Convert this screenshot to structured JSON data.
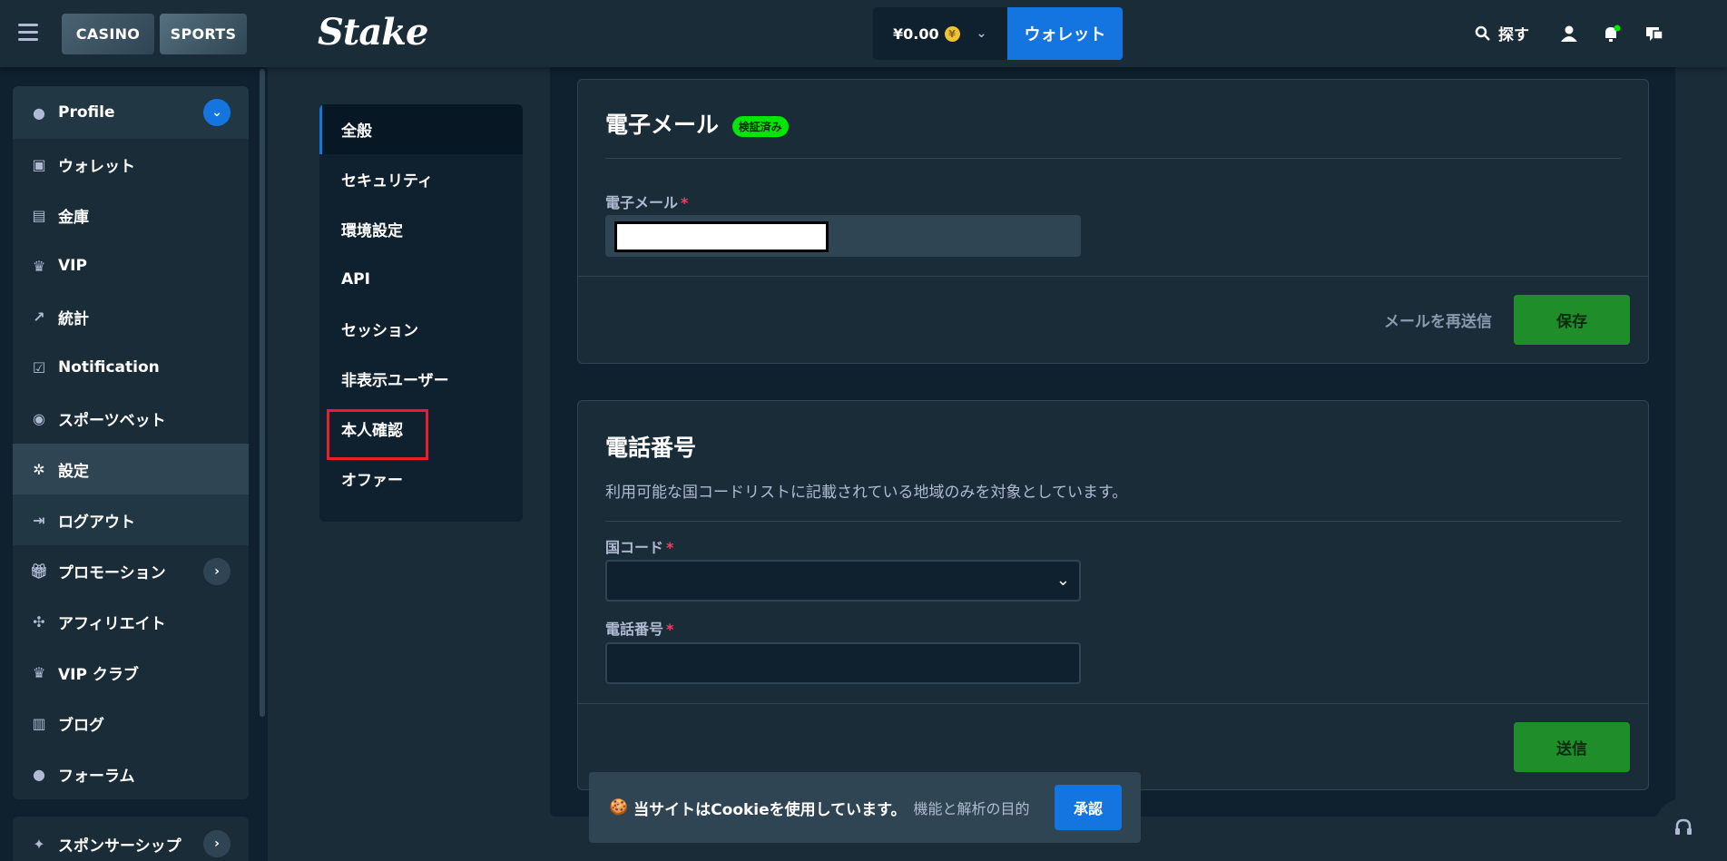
{
  "topbar": {
    "casino": "CASINO",
    "sports": "SPORTS",
    "logo": "Stake",
    "balance": "¥0.00",
    "coin_symbol": "¥",
    "wallet": "ウォレット",
    "search": "探す"
  },
  "sidebar": {
    "items": [
      {
        "label": "Profile",
        "icon": "user-icon"
      },
      {
        "label": "ウォレット",
        "icon": "wallet-icon"
      },
      {
        "label": "金庫",
        "icon": "vault-icon"
      },
      {
        "label": "VIP",
        "icon": "trophy-icon"
      },
      {
        "label": "統計",
        "icon": "stats-icon"
      },
      {
        "label": "Notification",
        "icon": "notification-icon"
      },
      {
        "label": "スポーツベット",
        "icon": "sports-icon"
      },
      {
        "label": "設定",
        "icon": "gear-icon"
      },
      {
        "label": "ログアウト",
        "icon": "logout-icon"
      },
      {
        "label": "プロモーション",
        "icon": "gift-icon"
      },
      {
        "label": "アフィリエイト",
        "icon": "affiliate-icon"
      },
      {
        "label": "VIP クラブ",
        "icon": "trophy-icon"
      },
      {
        "label": "ブログ",
        "icon": "blog-icon"
      },
      {
        "label": "フォーラム",
        "icon": "chat-icon"
      }
    ],
    "sponsorship": "スポンサーシップ"
  },
  "settings_nav": {
    "items": [
      "全般",
      "セキュリティ",
      "環境設定",
      "API",
      "セッション",
      "非表示ユーザー",
      "本人確認",
      "オファー"
    ],
    "active_index": 0,
    "highlighted_index": 6
  },
  "email_card": {
    "title": "電子メール",
    "badge": "検証済み",
    "field_label": "電子メール",
    "required_mark": "*",
    "resend": "メールを再送信",
    "save": "保存"
  },
  "phone_card": {
    "title": "電話番号",
    "description": "利用可能な国コードリストに記載されている地域のみを対象としています。",
    "country_label": "国コード",
    "phone_label": "電話番号",
    "required_mark": "*",
    "submit": "送信"
  },
  "cookie": {
    "emoji": "🍪",
    "text": "当サイトはCookieを使用しています。",
    "sub": "機能と解析の目的",
    "accept": "承認"
  },
  "colors": {
    "bg": "#0f212e",
    "panel": "#1a2c38",
    "accent_blue": "#1475e1",
    "green": "#1f8e2a",
    "verified": "#00e701",
    "highlight_red": "#e8202a"
  }
}
